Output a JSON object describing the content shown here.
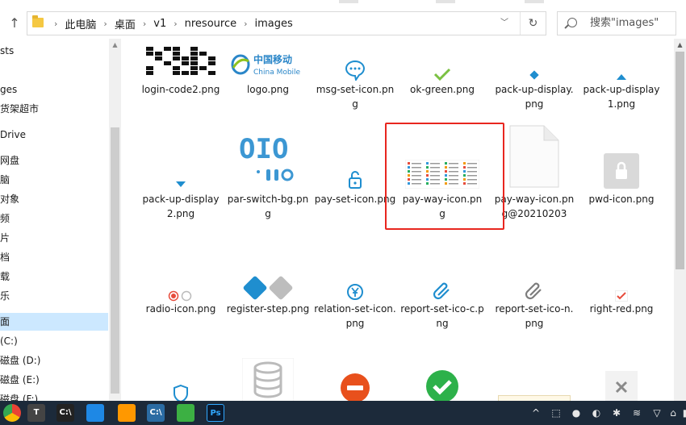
{
  "address": {
    "crumbs": [
      "此电脑",
      "桌面",
      "v1",
      "nresource",
      "images"
    ],
    "up_icon": "↑"
  },
  "search": {
    "placeholder": "搜索\"images\""
  },
  "sidebar": {
    "items": [
      {
        "label": "sts"
      },
      {
        "label": "ges"
      },
      {
        "label": "货架超市"
      },
      {
        "label": "Drive"
      },
      {
        "label": "网盘"
      },
      {
        "label": "脑"
      },
      {
        "label": "对象"
      },
      {
        "label": "频"
      },
      {
        "label": "片"
      },
      {
        "label": "档"
      },
      {
        "label": "载"
      },
      {
        "label": "乐"
      },
      {
        "label": "面"
      },
      {
        "label": "(C:)"
      },
      {
        "label": "磁盘 (D:)"
      },
      {
        "label": "磁盘 (E:)"
      },
      {
        "label": "磁盘 (F:)"
      }
    ]
  },
  "thumb_text": {
    "china_mobile_cn": "中国移动",
    "china_mobile_en": "China Mobile",
    "par_switch": "OIO"
  },
  "files": [
    {
      "name": "login-code2.png",
      "kind": "qr"
    },
    {
      "name": "logo.png",
      "kind": "china-mobile"
    },
    {
      "name": "msg-set-icon.png",
      "kind": "msg"
    },
    {
      "name": "ok-green.png",
      "kind": "check"
    },
    {
      "name": "pack-up-display.png",
      "kind": "diamond"
    },
    {
      "name": "pack-up-display1.png",
      "kind": "tri-up"
    },
    {
      "name": "pack-up-display2.png",
      "kind": "tri-down"
    },
    {
      "name": "par-switch-bg.png",
      "kind": "par-switch"
    },
    {
      "name": "pay-set-icon.png",
      "kind": "lock-blue"
    },
    {
      "name": "pay-way-icon.png",
      "kind": "payway"
    },
    {
      "name": "pay-way-icon.png@20210203",
      "kind": "blank-doc"
    },
    {
      "name": "pwd-icon.png",
      "kind": "pwd"
    },
    {
      "name": "radio-icon.png",
      "kind": "radio"
    },
    {
      "name": "register-step.png",
      "kind": "diamonds"
    },
    {
      "name": "relation-set-icon.png",
      "kind": "relation"
    },
    {
      "name": "report-set-ico-c.png",
      "kind": "clip-blue"
    },
    {
      "name": "report-set-ico-n.png",
      "kind": "clip-gray"
    },
    {
      "name": "right-red.png",
      "kind": "check-red"
    },
    {
      "name": "",
      "kind": "shield"
    },
    {
      "name": "",
      "kind": "db"
    },
    {
      "name": "",
      "kind": "stop"
    },
    {
      "name": "",
      "kind": "green-check"
    },
    {
      "name": "",
      "kind": "paper"
    },
    {
      "name": "",
      "kind": "x-gray"
    }
  ],
  "selected_file": "pay-way-icon.png",
  "taskbar": {
    "apps": [
      {
        "icon": "chrome-icon"
      },
      {
        "icon": "typora-icon",
        "glyph": "T"
      },
      {
        "icon": "cmd-icon",
        "glyph": "C:\\"
      },
      {
        "icon": "vscode-icon"
      },
      {
        "icon": "sublime-icon"
      },
      {
        "icon": "terminal-icon",
        "glyph": "C:\\"
      },
      {
        "icon": "wechat-icon"
      },
      {
        "icon": "photoshop-icon",
        "glyph": "Ps"
      }
    ],
    "tray": [
      "^",
      "⬚",
      "●",
      "◐",
      "✱",
      "≋",
      "▽",
      "⌂",
      "▮"
    ]
  },
  "colors": {
    "accent_select": "#cce8ff",
    "highlight_border": "#e8261f",
    "taskbar": "#1c2a3a",
    "china_mobile_blue": "#2a86c8"
  }
}
